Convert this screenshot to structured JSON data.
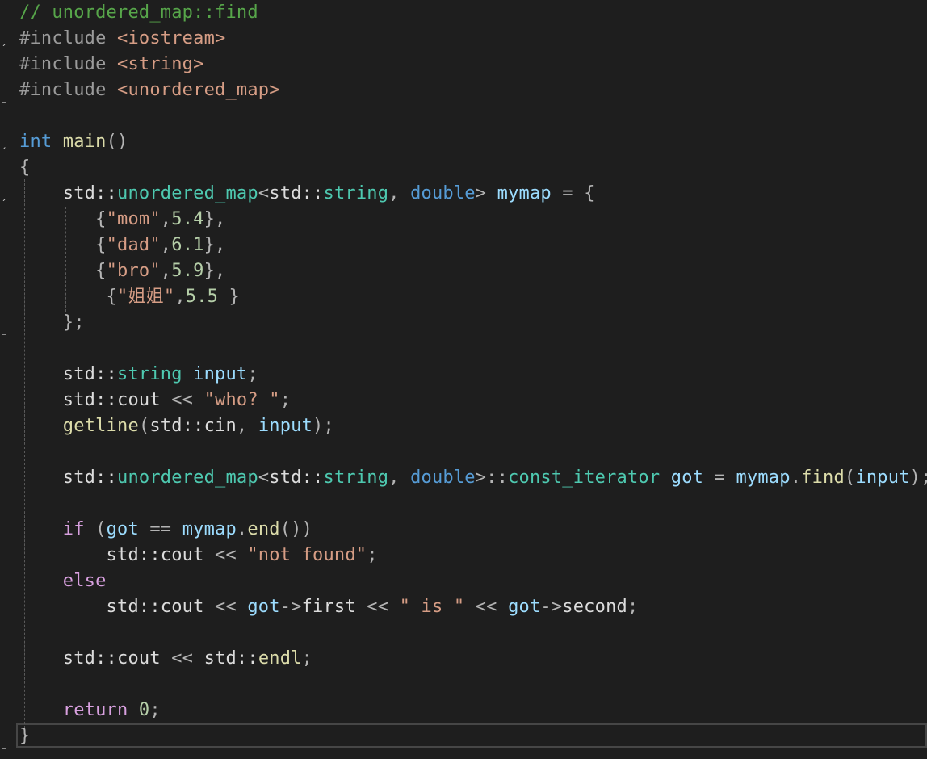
{
  "editor": {
    "language": "C++",
    "colors": {
      "background": "#1e1e1e",
      "comment": "#57a64a",
      "preprocessor": "#9b9b9b",
      "include_path": "#d69d85",
      "keyword": "#569cd6",
      "control": "#d8a0df",
      "type": "#4ec9b0",
      "function": "#dcdcaa",
      "variable": "#9cdcfe",
      "string": "#d69d85",
      "number": "#b5cea8",
      "punctuation": "#b4b4b4",
      "plain": "#dcdcdc"
    },
    "lines": [
      [
        [
          "comment",
          "// unordered_map::find"
        ]
      ],
      [
        [
          "pre",
          "#include "
        ],
        [
          "incl",
          "<iostream>"
        ]
      ],
      [
        [
          "pre",
          "#include "
        ],
        [
          "incl",
          "<string>"
        ]
      ],
      [
        [
          "pre",
          "#include "
        ],
        [
          "incl",
          "<unordered_map>"
        ]
      ],
      [],
      [
        [
          "kw",
          "int"
        ],
        [
          "plain",
          " "
        ],
        [
          "fn",
          "main"
        ],
        [
          "punc",
          "()"
        ]
      ],
      [
        [
          "punc",
          "{"
        ]
      ],
      [
        [
          "plain",
          "    std::"
        ],
        [
          "type",
          "unordered_map"
        ],
        [
          "punc",
          "<"
        ],
        [
          "plain",
          "std::"
        ],
        [
          "type",
          "string"
        ],
        [
          "punc",
          ", "
        ],
        [
          "kw",
          "double"
        ],
        [
          "punc",
          "> "
        ],
        [
          "var",
          "mymap"
        ],
        [
          "punc",
          " = {"
        ]
      ],
      [
        [
          "punc",
          "       {"
        ],
        [
          "str",
          "\"mom\""
        ],
        [
          "punc",
          ","
        ],
        [
          "num",
          "5.4"
        ],
        [
          "punc",
          "},"
        ]
      ],
      [
        [
          "punc",
          "       {"
        ],
        [
          "str",
          "\"dad\""
        ],
        [
          "punc",
          ","
        ],
        [
          "num",
          "6.1"
        ],
        [
          "punc",
          "},"
        ]
      ],
      [
        [
          "punc",
          "       {"
        ],
        [
          "str",
          "\"bro\""
        ],
        [
          "punc",
          ","
        ],
        [
          "num",
          "5.9"
        ],
        [
          "punc",
          "},"
        ]
      ],
      [
        [
          "punc",
          "        {"
        ],
        [
          "str",
          "\"姐姐\""
        ],
        [
          "punc",
          ","
        ],
        [
          "num",
          "5.5"
        ],
        [
          "punc",
          " }"
        ]
      ],
      [
        [
          "punc",
          "    };"
        ]
      ],
      [],
      [
        [
          "plain",
          "    std::"
        ],
        [
          "type",
          "string"
        ],
        [
          "plain",
          " "
        ],
        [
          "var",
          "input"
        ],
        [
          "punc",
          ";"
        ]
      ],
      [
        [
          "plain",
          "    std::cout "
        ],
        [
          "punc",
          "<< "
        ],
        [
          "str",
          "\"who? \""
        ],
        [
          "punc",
          ";"
        ]
      ],
      [
        [
          "plain",
          "    "
        ],
        [
          "fn",
          "getline"
        ],
        [
          "punc",
          "("
        ],
        [
          "plain",
          "std::cin"
        ],
        [
          "punc",
          ", "
        ],
        [
          "var",
          "input"
        ],
        [
          "punc",
          ");"
        ]
      ],
      [],
      [
        [
          "plain",
          "    std::"
        ],
        [
          "type",
          "unordered_map"
        ],
        [
          "punc",
          "<"
        ],
        [
          "plain",
          "std::"
        ],
        [
          "type",
          "string"
        ],
        [
          "punc",
          ", "
        ],
        [
          "kw",
          "double"
        ],
        [
          "punc",
          ">::"
        ],
        [
          "type",
          "const_iterator"
        ],
        [
          "plain",
          " "
        ],
        [
          "var",
          "got"
        ],
        [
          "punc",
          " = "
        ],
        [
          "var",
          "mymap"
        ],
        [
          "punc",
          "."
        ],
        [
          "fn",
          "find"
        ],
        [
          "punc",
          "("
        ],
        [
          "var",
          "input"
        ],
        [
          "punc",
          ");"
        ]
      ],
      [],
      [
        [
          "ctrl",
          "    if"
        ],
        [
          "punc",
          " ("
        ],
        [
          "var",
          "got"
        ],
        [
          "punc",
          " == "
        ],
        [
          "var",
          "mymap"
        ],
        [
          "punc",
          "."
        ],
        [
          "fn",
          "end"
        ],
        [
          "punc",
          "())"
        ]
      ],
      [
        [
          "plain",
          "        std::cout "
        ],
        [
          "punc",
          "<< "
        ],
        [
          "str",
          "\"not found\""
        ],
        [
          "punc",
          ";"
        ]
      ],
      [
        [
          "ctrl",
          "    else"
        ]
      ],
      [
        [
          "plain",
          "        std::cout "
        ],
        [
          "punc",
          "<< "
        ],
        [
          "var",
          "got"
        ],
        [
          "punc",
          "->"
        ],
        [
          "plain",
          "first "
        ],
        [
          "punc",
          "<< "
        ],
        [
          "str",
          "\" is \""
        ],
        [
          "punc",
          " << "
        ],
        [
          "var",
          "got"
        ],
        [
          "punc",
          "->"
        ],
        [
          "plain",
          "second"
        ],
        [
          "punc",
          ";"
        ]
      ],
      [],
      [
        [
          "plain",
          "    std::cout "
        ],
        [
          "punc",
          "<< "
        ],
        [
          "plain",
          "std::"
        ],
        [
          "fn",
          "endl"
        ],
        [
          "punc",
          ";"
        ]
      ],
      [],
      [
        [
          "ctrl",
          "    return"
        ],
        [
          "plain",
          " "
        ],
        [
          "num",
          "0"
        ],
        [
          "punc",
          ";"
        ]
      ],
      [
        [
          "punc",
          "}"
        ]
      ]
    ]
  }
}
